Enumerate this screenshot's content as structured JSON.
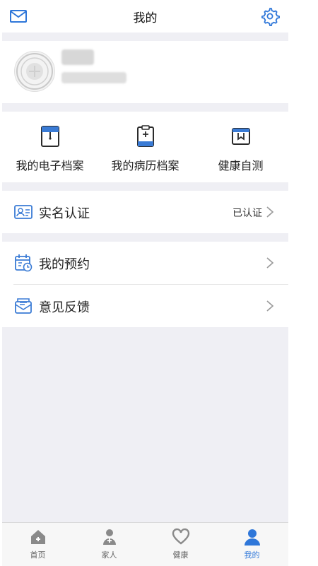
{
  "nav": {
    "title": "我的",
    "mail_icon": "mail-icon",
    "settings_icon": "gear-icon"
  },
  "profile": {
    "name": "██",
    "phone": "███████████"
  },
  "shortcuts": [
    {
      "label": "我的电子档案",
      "icon": "document-folder-icon"
    },
    {
      "label": "我的病历档案",
      "icon": "clipboard-plus-icon"
    },
    {
      "label": "健康自测",
      "icon": "bookmark-card-icon"
    }
  ],
  "certification": {
    "label": "实名认证",
    "status": "已认证",
    "icon": "id-card-icon"
  },
  "menu": [
    {
      "label": "我的预约",
      "icon": "calendar-clock-icon"
    },
    {
      "label": "意见反馈",
      "icon": "feedback-envelope-icon"
    }
  ],
  "tabbar": [
    {
      "label": "首页",
      "icon": "home-icon",
      "active": false
    },
    {
      "label": "家人",
      "icon": "family-doctor-icon",
      "active": false
    },
    {
      "label": "健康",
      "icon": "heart-icon",
      "active": false
    },
    {
      "label": "我的",
      "icon": "person-icon",
      "active": true
    }
  ],
  "colors": {
    "accent": "#2f77d9",
    "background": "#efeff4"
  }
}
